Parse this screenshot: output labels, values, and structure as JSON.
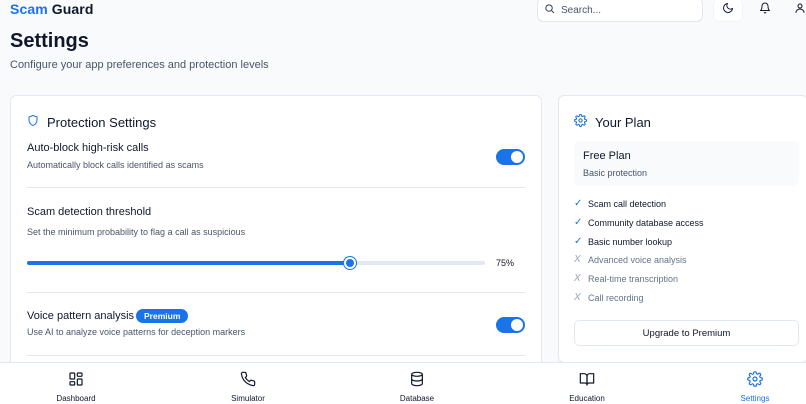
{
  "header": {
    "brand_part1": "Scam",
    "brand_part2": "Guard",
    "search_placeholder": "Search..."
  },
  "page": {
    "title": "Settings",
    "subtitle": "Configure your app preferences and protection levels"
  },
  "protection": {
    "heading": "Protection Settings",
    "auto_block": {
      "title": "Auto-block high-risk calls",
      "desc": "Automatically block calls identified as scams",
      "enabled": true
    },
    "threshold": {
      "title": "Scam detection threshold",
      "desc": "Set the minimum probability to flag a call as suspicious",
      "value": 75,
      "value_label": "75%"
    },
    "voice": {
      "title": "Voice pattern analysis",
      "badge": "Premium",
      "desc": "Use AI to analyze voice patterns for deception markers",
      "enabled": true
    }
  },
  "plan": {
    "heading": "Your Plan",
    "name": "Free Plan",
    "desc": "Basic protection",
    "features": [
      {
        "label": "Scam call detection",
        "included": true,
        "mark": "✓"
      },
      {
        "label": "Community database access",
        "included": true,
        "mark": "✓"
      },
      {
        "label": "Basic number lookup",
        "included": true,
        "mark": "✓"
      },
      {
        "label": "Advanced voice analysis",
        "included": false,
        "mark": "X"
      },
      {
        "label": "Real-time transcription",
        "included": false,
        "mark": "X"
      },
      {
        "label": "Call recording",
        "included": false,
        "mark": "X"
      }
    ],
    "upgrade_label": "Upgrade to Premium"
  },
  "nav": {
    "items": [
      {
        "label": "Dashboard",
        "icon": "dashboard-grid-icon",
        "active": false
      },
      {
        "label": "Simulator",
        "icon": "phone-icon",
        "active": false
      },
      {
        "label": "Database",
        "icon": "database-icon",
        "active": false
      },
      {
        "label": "Education",
        "icon": "book-icon",
        "active": false
      },
      {
        "label": "Settings",
        "icon": "gear-icon",
        "active": true
      }
    ]
  },
  "colors": {
    "accent": "#1a73e8",
    "text": "#0f172a",
    "muted": "#475569"
  }
}
